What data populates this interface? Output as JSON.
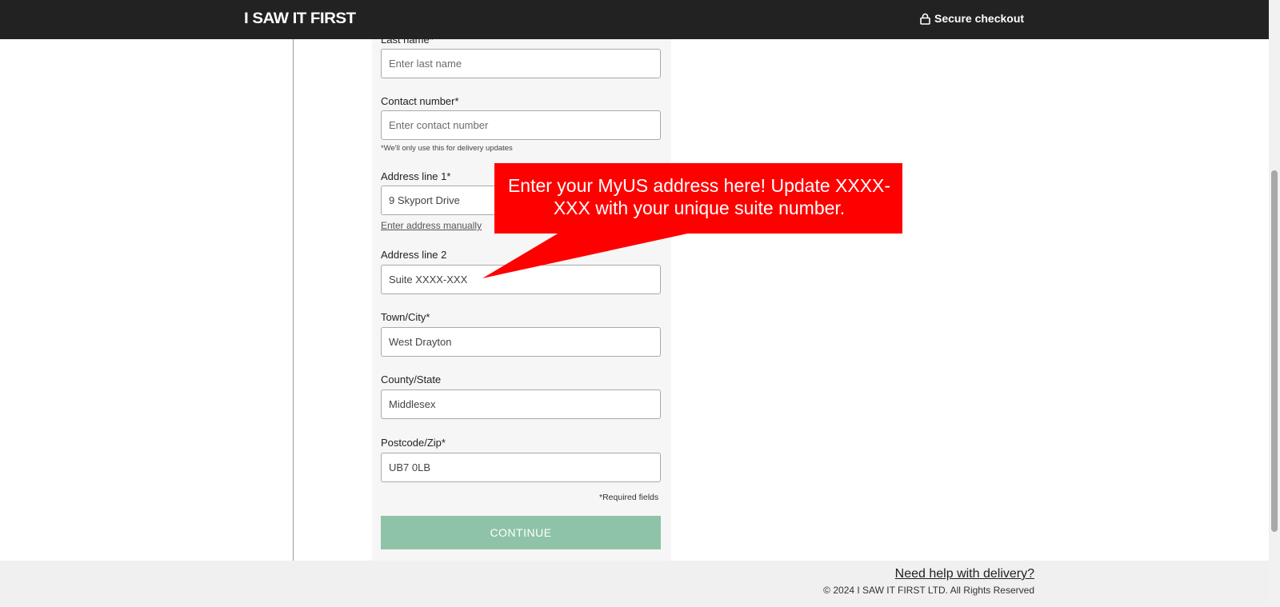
{
  "header": {
    "logo": "I SAW IT FIRST",
    "secure_label": "Secure checkout"
  },
  "form": {
    "fields": [
      {
        "label": "Last name*",
        "value": "",
        "placeholder": "Enter last name"
      },
      {
        "label": "Contact number*",
        "value": "",
        "placeholder": "Enter contact number",
        "hint": "*We'll only use this for delivery updates"
      },
      {
        "label": "Address line 1*",
        "value": "9 Skyport Drive",
        "placeholder": ""
      },
      {
        "label": "Address line 2",
        "value": "Suite XXXX-XXX",
        "placeholder": ""
      },
      {
        "label": "Town/City*",
        "value": "West Drayton",
        "placeholder": ""
      },
      {
        "label": "County/State",
        "value": "Middlesex",
        "placeholder": ""
      },
      {
        "label": "Postcode/Zip*",
        "value": "UB7 0LB",
        "placeholder": ""
      }
    ],
    "manual_link": "Enter address manually",
    "required_note": "*Required fields",
    "continue_label": "CONTINUE"
  },
  "callout": {
    "text": "Enter your MyUS address here! Update XXXX-XXX with your unique suite number.",
    "color": "#ff0000"
  },
  "footer": {
    "help_link": "Need help with delivery?",
    "copyright": "© 2024 I SAW IT FIRST LTD. All Rights Reserved"
  },
  "colors": {
    "topbar": "#222222",
    "button": "#8ec3a7",
    "panel": "#f6f6f6"
  }
}
